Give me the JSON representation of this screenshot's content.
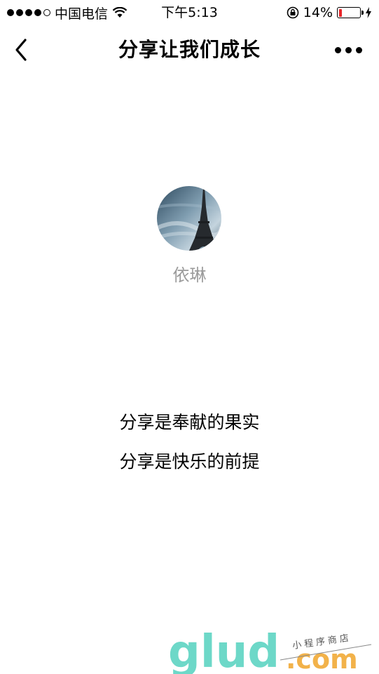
{
  "status_bar": {
    "carrier": "中国电信",
    "time": "下午5:13",
    "battery_percent": "14%",
    "battery_level": 0.14,
    "battery_color": "#e8262a"
  },
  "nav": {
    "title": "分享让我们成长"
  },
  "profile": {
    "username": "依琳"
  },
  "quotes": [
    "分享是奉献的果实",
    "分享是快乐的前提"
  ],
  "watermark": {
    "brand": "glud",
    "domain": ".com",
    "tagline": "小程序商店"
  }
}
